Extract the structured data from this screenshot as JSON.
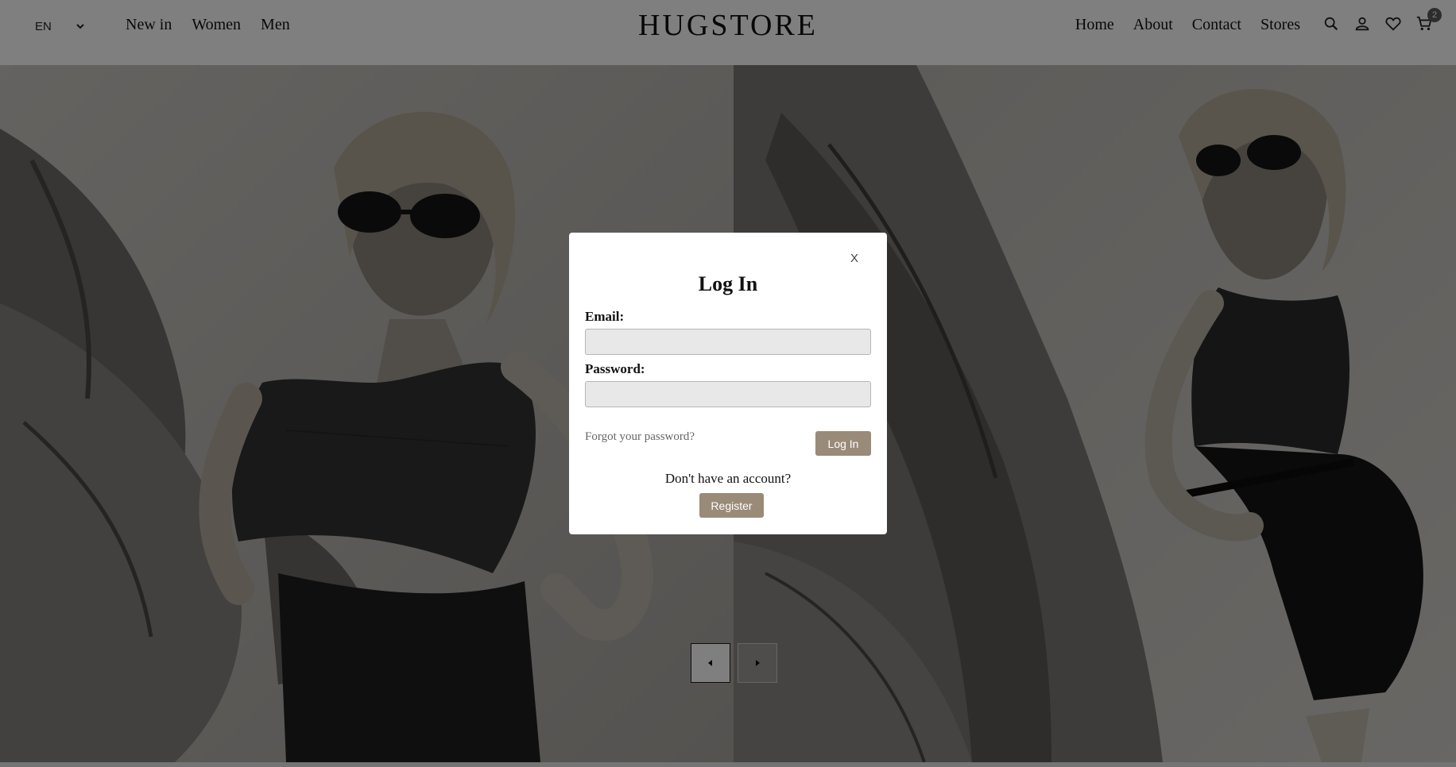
{
  "header": {
    "language": "EN",
    "nav_left": [
      "New in",
      "Women",
      "Men"
    ],
    "logo": "HUGSTORE",
    "nav_right": [
      "Home",
      "About",
      "Contact",
      "Stores"
    ],
    "icons": [
      "search-icon",
      "user-icon",
      "heart-icon",
      "cart-icon"
    ],
    "cart_count": "2"
  },
  "hero": {
    "images": [
      "model-sunglasses-photo",
      "model-leaning-photo"
    ],
    "slider_controls": [
      "prev-arrow",
      "next-arrow"
    ]
  },
  "modal": {
    "close_label": "X",
    "title": "Log In",
    "email_label": "Email:",
    "email_value": "",
    "password_label": "Password:",
    "password_value": "",
    "forgot_link": "Forgot your password?",
    "login_button": "Log In",
    "no_account_text": "Don't have an account?",
    "register_button": "Register"
  },
  "colors": {
    "accent_button": "#9a8a78",
    "overlay": "rgba(0,0,0,0.5)",
    "input_bg": "#e8e8e8",
    "cart_badge": "#5a5a5a"
  }
}
